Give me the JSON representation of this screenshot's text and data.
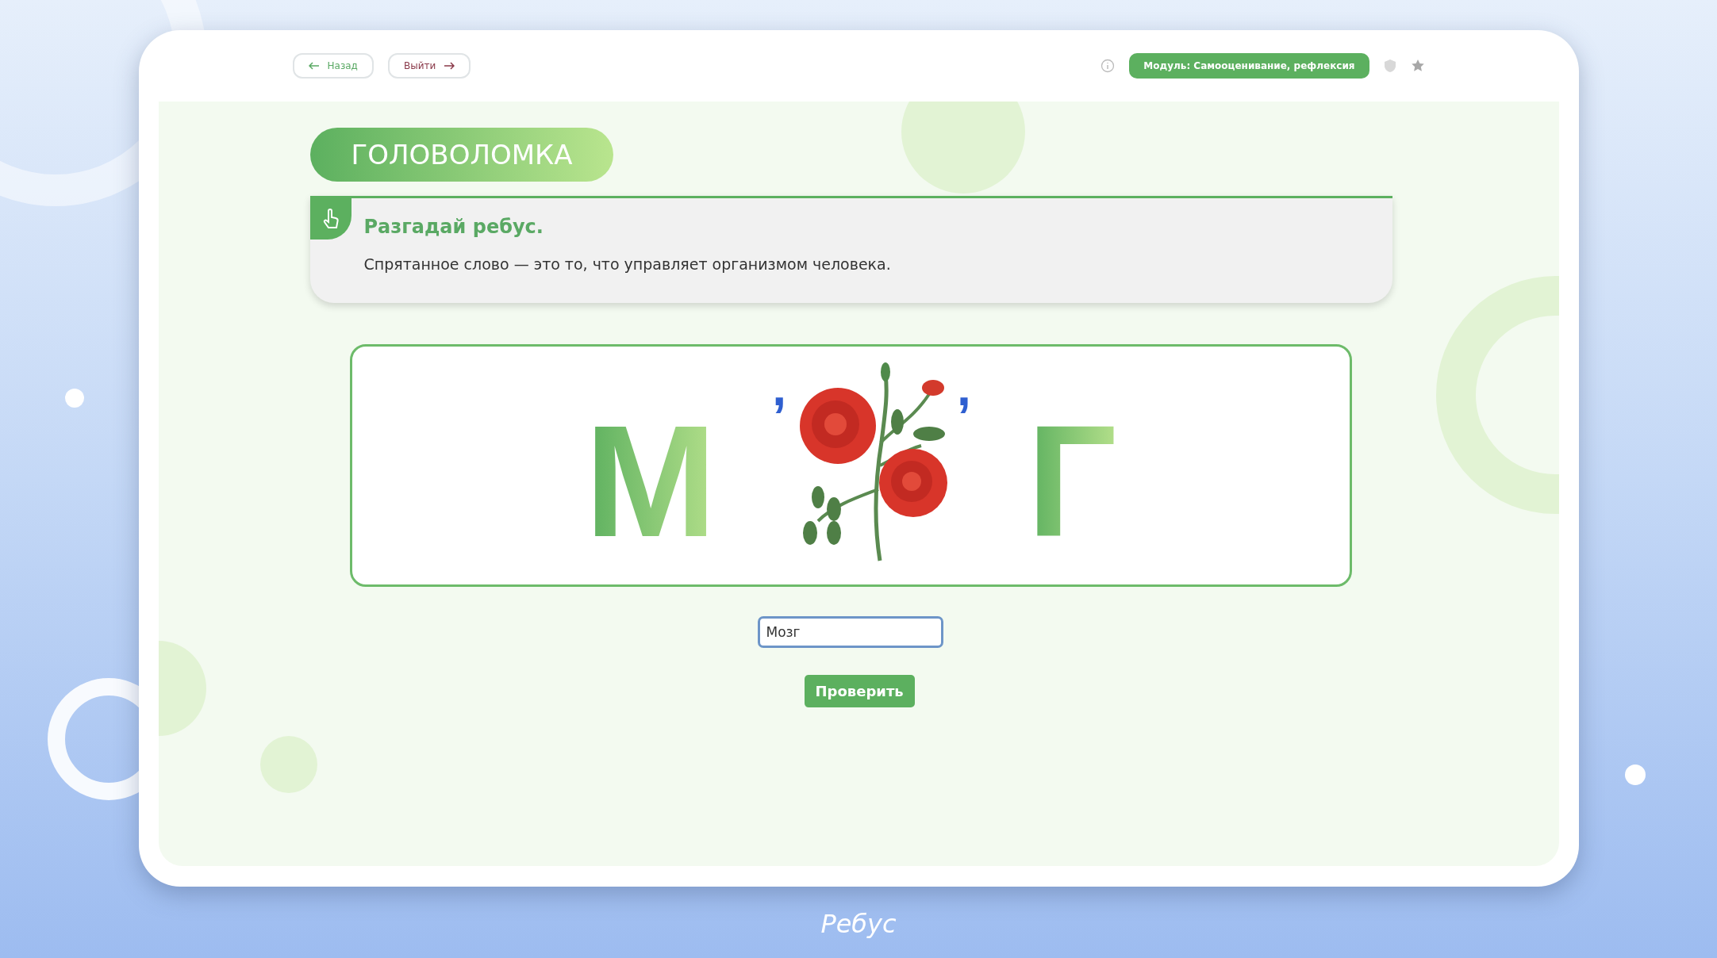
{
  "nav": {
    "back": "Назад",
    "exit": "Выйти",
    "module": "Модуль: Самооценивание, рефлексия"
  },
  "heading": "ГОЛОВОЛОМКА",
  "task": {
    "title": "Разгадай ребус.",
    "text": "Спрятанное слово — это то, что управляет организмом человека."
  },
  "rebus": [
    {
      "kind": "letter",
      "text": "М"
    },
    {
      "kind": "comma",
      "text": ","
    },
    {
      "kind": "picture"
    },
    {
      "kind": "comma",
      "text": ","
    },
    {
      "kind": "letter",
      "text": "Г"
    }
  ],
  "answer": {
    "value": "Мозг"
  },
  "check_button": "Проверить",
  "caption": "Ребус"
}
